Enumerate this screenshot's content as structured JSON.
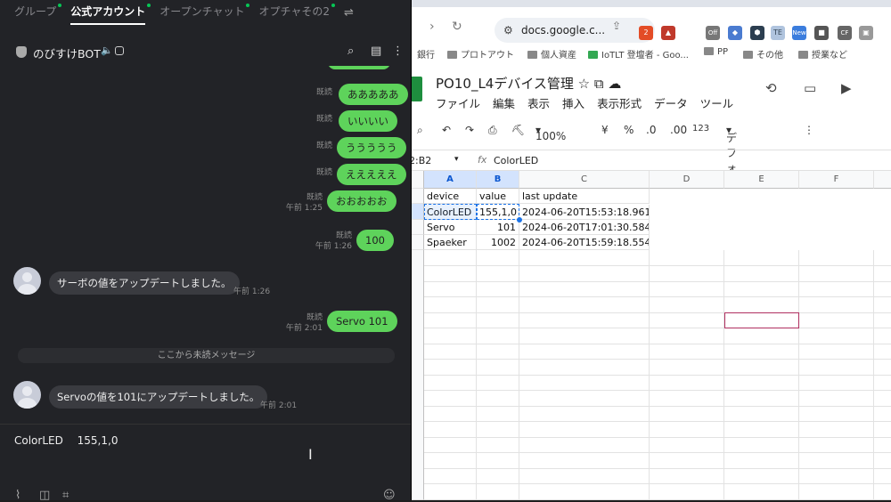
{
  "line": {
    "tabs": [
      "グループ",
      "公式アカウント",
      "オープンチャット",
      "オプチャその2"
    ],
    "chat_name": "のびすけBOT",
    "messages_sent": [
      {
        "text": "あああああ",
        "read": "既読",
        "time": ""
      },
      {
        "text": "いいいい",
        "read": "既読",
        "time": ""
      },
      {
        "text": "ううううう",
        "read": "既読",
        "time": ""
      },
      {
        "text": "えええええ",
        "read": "既読",
        "time": ""
      },
      {
        "text": "おおおおお",
        "read": "既読",
        "time": "午前 1:25"
      },
      {
        "text": "100",
        "read": "既読",
        "time": "午前 1:26"
      }
    ],
    "received_1": {
      "text": "サーボの値をアップデートしました。",
      "time": "午前 1:26"
    },
    "sent_servo": {
      "text": "Servo 101",
      "read": "既読",
      "time": "午前 2:01"
    },
    "unread_divider": "ここから未読メッセージ",
    "received_2": {
      "text": "Servoの値を101にアップデートしました。",
      "time": "午前 2:01"
    },
    "input_value": "ColorLED 　155,1,0"
  },
  "browser": {
    "url": "docs.google.c...",
    "bookmarks": [
      "銀行",
      "プロトアウト",
      "個人資産",
      "IoTLT 登壇者 - Goo...",
      "PP",
      "その他",
      "授業など"
    ],
    "extension_badges": [
      "2",
      "Off",
      "TE",
      "New",
      "CF"
    ]
  },
  "sheet": {
    "title": "PO10_L4デバイス管理",
    "menu": [
      "ファイル",
      "編集",
      "表示",
      "挿入",
      "表示形式",
      "データ",
      "ツール"
    ],
    "toolbar": {
      "zoom": "100%",
      "currency": "¥",
      "percent": "%",
      "dec_less": ".0",
      "dec_more": ".00",
      "format_123": "123",
      "font": "デフォ..."
    },
    "name_box": "2:B2",
    "formula": "ColorLED",
    "columns": [
      "A",
      "B",
      "C",
      "D",
      "E",
      "F"
    ],
    "rows": [
      [
        "device",
        "value",
        "last update"
      ],
      [
        "ColorLED",
        "155,1,0",
        "2024-06-20T15:53:18.961Z"
      ],
      [
        "Servo",
        "101",
        "2024-06-20T17:01:30.584Z"
      ],
      [
        "Spaeker",
        "1002",
        "2024-06-20T15:59:18.554Z"
      ]
    ]
  }
}
